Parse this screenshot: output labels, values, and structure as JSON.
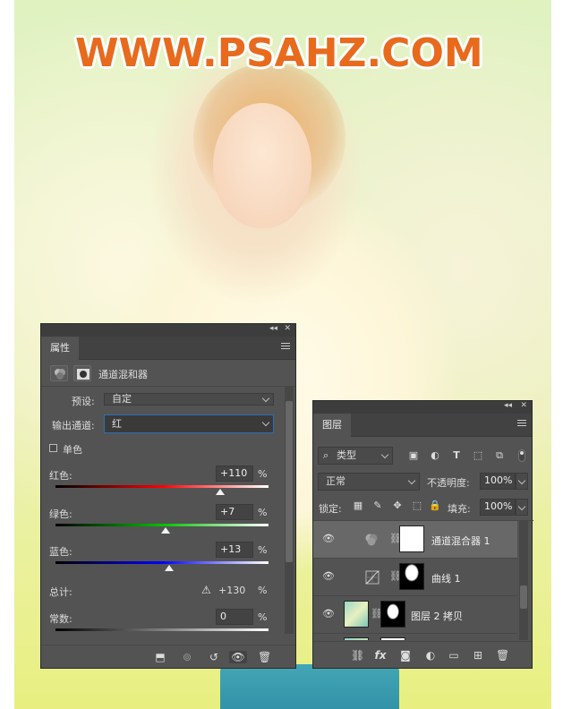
{
  "watermark": "WWW.PSAHZ.COM",
  "properties_panel": {
    "tab": "属性",
    "adjustment_title": "通道混和器",
    "preset_label": "预设:",
    "preset_value": "自定",
    "output_channel_label": "输出通道:",
    "output_channel_value": "红",
    "monochrome_label": "单色",
    "red_label": "红色:",
    "red_value": "+110",
    "red_level_percent": 110,
    "green_label": "绿色:",
    "green_value": "+7",
    "green_level_percent": 7,
    "blue_label": "蓝色:",
    "blue_value": "+13",
    "blue_level_percent": 13,
    "total_label": "总计:",
    "total_value": "+130",
    "constant_label": "常数:",
    "constant_value": "0",
    "percent": "%",
    "accent_focus": "#2d6fb6"
  },
  "layers_panel": {
    "tab": "图层",
    "filter_kind": "类型",
    "blend_mode": "正常",
    "opacity_label": "不透明度:",
    "opacity_value": "100%",
    "lock_label": "锁定:",
    "fill_label": "填充:",
    "fill_value": "100%",
    "layers": [
      {
        "name": "通道混合器 1",
        "type": "channel-mixer-adjustment",
        "selected": true
      },
      {
        "name": "曲线 1",
        "type": "curves-adjustment",
        "selected": false
      },
      {
        "name": "图层 2 拷贝",
        "type": "pixel-layer",
        "selected": false
      }
    ]
  },
  "icons": {
    "collapse": "double-chevron-icon",
    "close": "close-icon",
    "panel_menu": "menu-icon",
    "eye": "eye-icon",
    "link": "link-icon",
    "search": "search-icon",
    "trash": "trash-icon",
    "fx": "fx-icon",
    "mask": "mask-icon",
    "new_fill": "half-circle-icon",
    "folder": "folder-icon",
    "new_layer": "new-layer-icon"
  }
}
